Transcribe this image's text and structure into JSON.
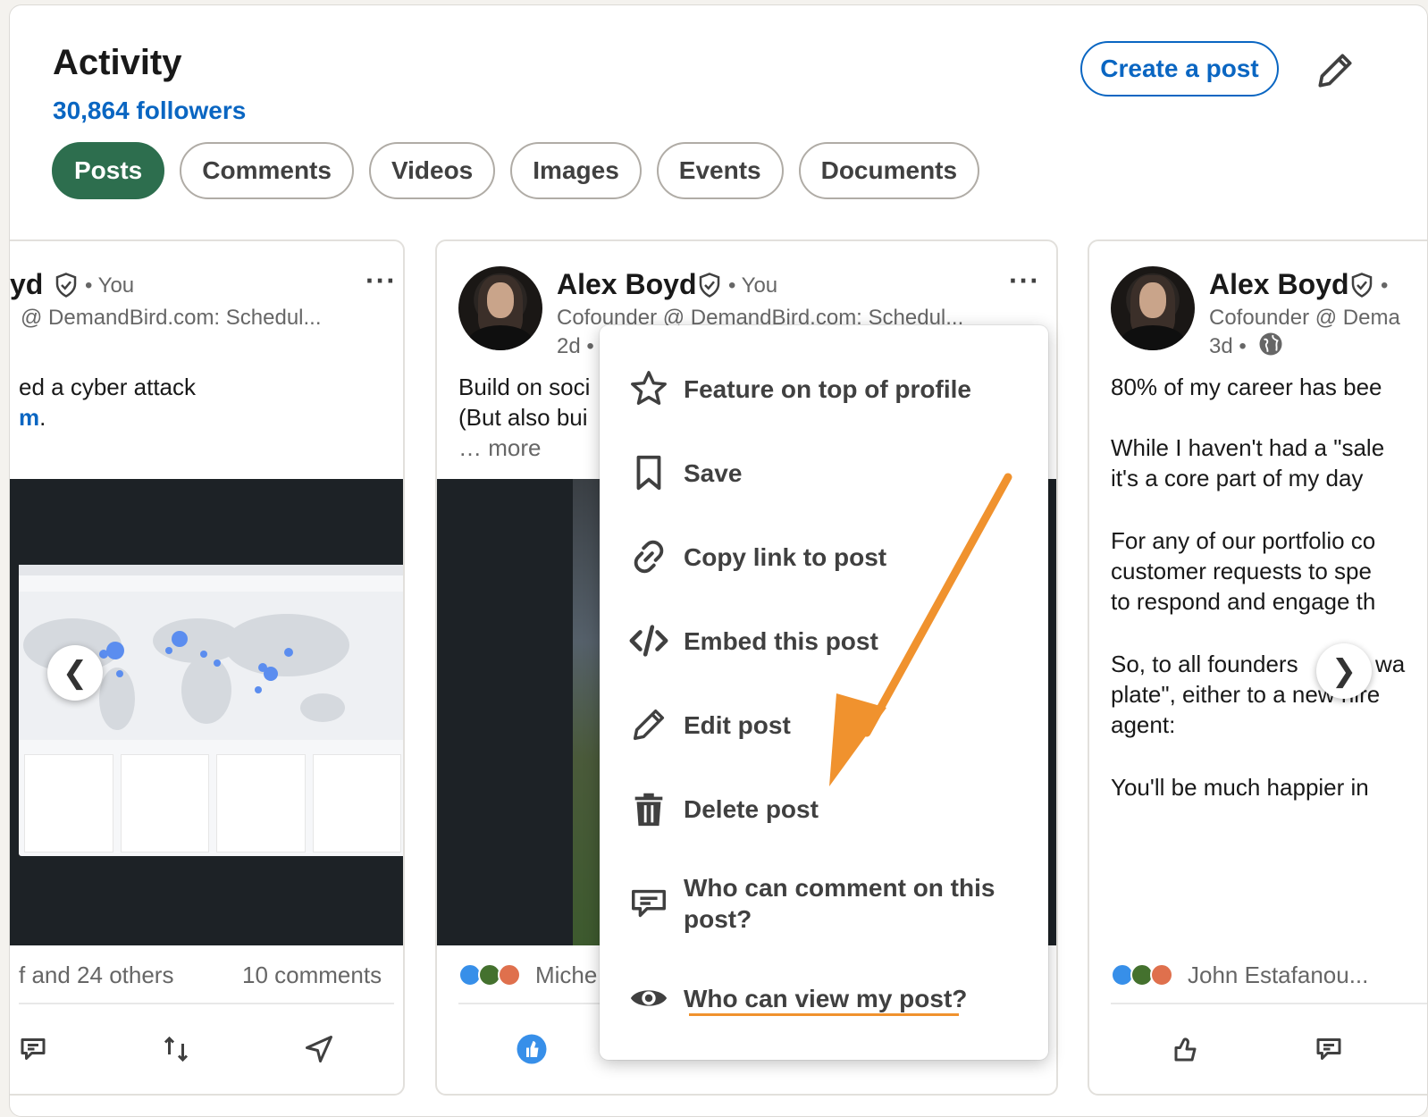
{
  "header": {
    "title": "Activity",
    "followers": "30,864 followers",
    "create_post": "Create a post"
  },
  "tabs": [
    {
      "label": "Posts",
      "active": true
    },
    {
      "label": "Comments"
    },
    {
      "label": "Videos"
    },
    {
      "label": "Images"
    },
    {
      "label": "Events"
    },
    {
      "label": "Documents"
    }
  ],
  "cards": {
    "left": {
      "name_fragment": "yd",
      "you": "• You",
      "headline": "@ DemandBird.com: Schedul...",
      "text_line1": "ed a cyber attack",
      "text_line2_link": "m",
      "text_line2_rest": ".",
      "social_left": "f and 24 others",
      "social_right": "10 comments"
    },
    "mid": {
      "name": "Alex Boyd",
      "you": "• You",
      "headline": "Cofounder @ DemandBird.com: Schedul...",
      "time": "2d •",
      "text_line1": "Build on soci",
      "text_line2": "(But also bui",
      "text_more": "… more",
      "social_left": "Miche"
    },
    "right": {
      "name": "Alex Boyd",
      "you": "•",
      "headline": "Cofounder @ Dema",
      "time": "3d •",
      "lines": [
        "80% of my career has bee",
        "While I haven't had a \"sale",
        "it's a core part of my day",
        "For any of our portfolio co",
        "customer requests to spe",
        "to respond and engage th",
        "So, to all founders",
        "wa",
        "plate\", either to a new hire",
        "agent:",
        "You'll be much happier in"
      ],
      "social_left": "John Estafanou..."
    }
  },
  "menu": {
    "items": [
      {
        "label": "Feature on top of profile",
        "icon": "star-icon"
      },
      {
        "label": "Save",
        "icon": "bookmark-icon"
      },
      {
        "label": "Copy link to post",
        "icon": "link-icon"
      },
      {
        "label": "Embed this post",
        "icon": "code-icon"
      },
      {
        "label": "Edit post",
        "icon": "pencil-icon"
      },
      {
        "label": "Delete post",
        "icon": "trash-icon"
      },
      {
        "label": "Who can comment on this post?",
        "icon": "comment-icon"
      },
      {
        "label": "Who can view my post?",
        "icon": "eye-icon"
      }
    ]
  },
  "colors": {
    "brand_blue": "#0a66c2",
    "active_pill": "#2d6e4e",
    "annotation_orange": "#f0922e"
  }
}
